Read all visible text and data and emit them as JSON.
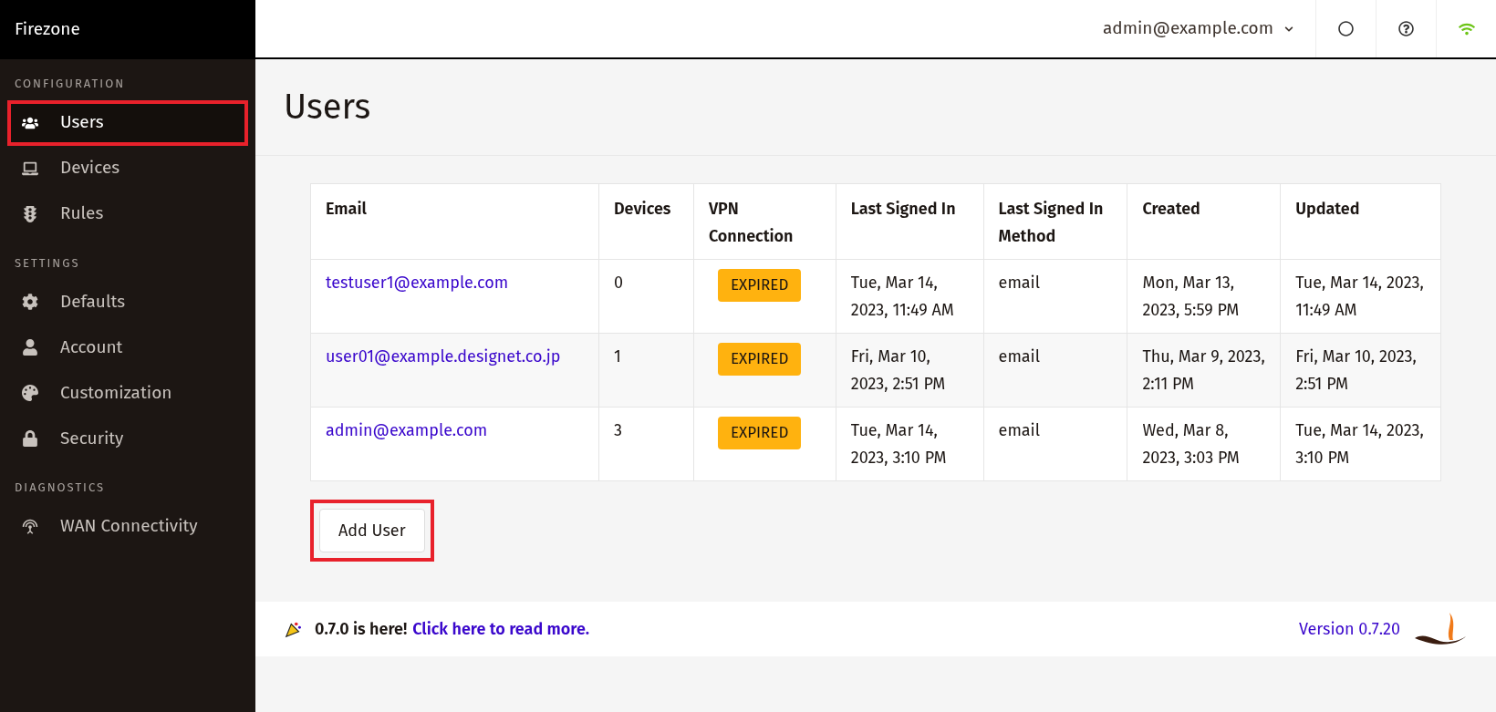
{
  "sidebar": {
    "brand": "Firezone",
    "sections": [
      {
        "heading": "CONFIGURATION",
        "items": [
          {
            "label": "Users",
            "kind": "users",
            "selected": true,
            "highlighted": true
          },
          {
            "label": "Devices",
            "kind": "laptop",
            "selected": false,
            "highlighted": false
          },
          {
            "label": "Rules",
            "kind": "traffic",
            "selected": false,
            "highlighted": false
          }
        ]
      },
      {
        "heading": "SETTINGS",
        "items": [
          {
            "label": "Defaults",
            "kind": "gear",
            "selected": false,
            "highlighted": false
          },
          {
            "label": "Account",
            "kind": "person",
            "selected": false,
            "highlighted": false
          },
          {
            "label": "Customization",
            "kind": "palette",
            "selected": false,
            "highlighted": false
          },
          {
            "label": "Security",
            "kind": "lock",
            "selected": false,
            "highlighted": false
          }
        ]
      },
      {
        "heading": "DIAGNOSTICS",
        "items": [
          {
            "label": "WAN Connectivity",
            "kind": "signal",
            "selected": false,
            "highlighted": false
          }
        ]
      }
    ]
  },
  "header": {
    "account": "admin@example.com"
  },
  "page": {
    "title": "Users"
  },
  "table": {
    "columns": [
      "Email",
      "Devices",
      "VPN Connection",
      "Last Signed In",
      "Last Signed In Method",
      "Created",
      "Updated"
    ],
    "rows": [
      {
        "email": "testuser1@example.com",
        "devices": "0",
        "vpn": "EXPIRED",
        "last_signed_in": "Tue, Mar 14, 2023, 11:49 AM",
        "method": "email",
        "created": "Mon, Mar 13, 2023, 5:59 PM",
        "updated": "Tue, Mar 14, 2023, 11:49 AM"
      },
      {
        "email": "user01@example.designet.co.jp",
        "devices": "1",
        "vpn": "EXPIRED",
        "last_signed_in": "Fri, Mar 10, 2023, 2:51 PM",
        "method": "email",
        "created": "Thu, Mar 9, 2023, 2:11 PM",
        "updated": "Fri, Mar 10, 2023, 2:51 PM"
      },
      {
        "email": "admin@example.com",
        "devices": "3",
        "vpn": "EXPIRED",
        "last_signed_in": "Tue, Mar 14, 2023, 3:10 PM",
        "method": "email",
        "created": "Wed, Mar 8, 2023, 3:03 PM",
        "updated": "Tue, Mar 14, 2023, 3:10 PM"
      }
    ]
  },
  "add_button": {
    "label": "Add User",
    "highlighted": true
  },
  "footer": {
    "announcement": "0.7.0 is here!",
    "link": "Click here to read more.",
    "version": "Version 0.7.20"
  }
}
